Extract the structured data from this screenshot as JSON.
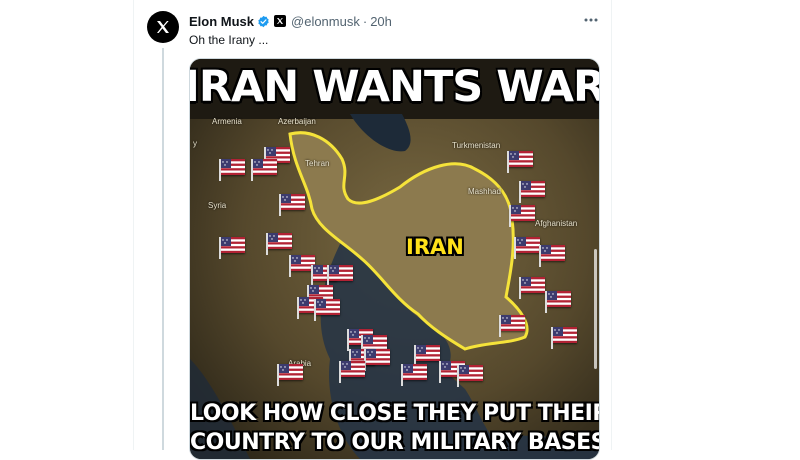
{
  "tweet": {
    "author_name": "Elon Musk",
    "handle": "@elonmusk",
    "separator": "·",
    "time": "20h",
    "text": "Oh the Irany ...",
    "avatar_icon": "x-logo-icon",
    "verified_color": "#1d9bf0"
  },
  "media": {
    "headline": "IRAN WANTS WAR",
    "country_label": "IRAN",
    "caption_line1": "LOOK HOW CLOSE THEY PUT THEIR",
    "caption_line2": "COUNTRY TO OUR MILITARY BASES",
    "places": {
      "azerbaijan": "Azerbaijan",
      "armenia": "Armenia",
      "turkmenistan": "Turkmenistan",
      "afghanistan": "Afghanistan",
      "arabia": "Arabia",
      "edge_y": "y",
      "tehran": "Tehran",
      "mashhad": "Mashhad",
      "syria": "Syria"
    },
    "flag_count": 33,
    "outline_color": "#f5e33a"
  }
}
